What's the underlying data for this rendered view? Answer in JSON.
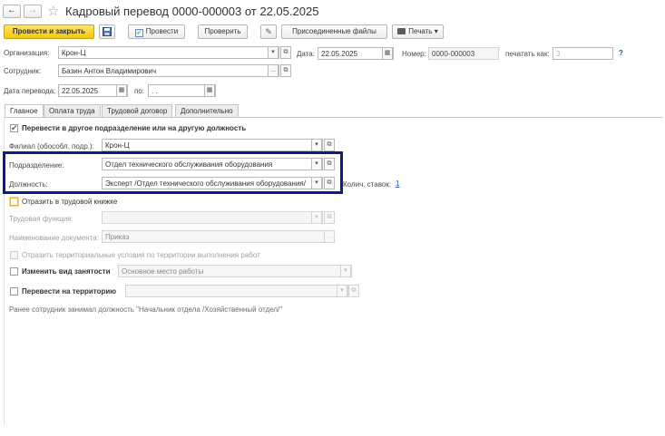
{
  "window": {
    "title": "Кадровый перевод 0000-000003 от 22.05.2025",
    "back_glyph": "←",
    "forward_glyph": "→",
    "star_glyph": "☆"
  },
  "toolbar": {
    "post_close": "Провести и закрыть",
    "save_icon": "floppy-disk-icon",
    "post": "Провести",
    "check": "Проверить",
    "attached_files": "Присоединенные файлы",
    "print": "Печать",
    "print_arrow": "▾"
  },
  "header": {
    "org_label": "Организация:",
    "org_value": "Крон-Ц",
    "date_label": "Дата:",
    "date_value": "22.05.2025",
    "number_label": "Номер:",
    "number_value": "0000-000003",
    "print_as_label": "печатать как:",
    "print_as_placeholder": "3",
    "help": "?",
    "employee_label": "Сотрудник:",
    "employee_value": "Базин Антон Владимирович",
    "transfer_date_label": "Дата перевода:",
    "transfer_date_value": "22.05.2025",
    "to_label": "по:",
    "to_value": " .  .",
    "dots": "...",
    "open_glyph": "⧉",
    "dropdown_glyph": "▾",
    "calendar_glyph": "▦"
  },
  "tabs": [
    "Главное",
    "Оплата труда",
    "Трудовой договор",
    "Дополнительно"
  ],
  "main": {
    "transfer_check": "✔",
    "transfer_label": "Перевести в другое подразделение или на другую должность",
    "branch_label": "Филиал (обособл. подр.):",
    "branch_value": "Крон-Ц",
    "department_label": "Подразделение:",
    "department_value": "Отдел технического обслуживания оборудования",
    "position_label": "Должность:",
    "position_value": "Эксперт /Отдел технического обслуживания оборудования/",
    "rates_label": "Колич. ставок:",
    "rates_value": "1",
    "workbook_label": "Отразить в трудовой книжке",
    "labor_function_label": "Трудовая функция:",
    "doc_name_label": "Наименование документа:",
    "doc_name_value": "Приказ",
    "territorial_label": "Отразить территориальные условия по территории выполнения работ",
    "employment_type_label": "Изменить вид занятости",
    "employment_type_value": "Основное место работы",
    "territory_label": "Перевести на территорию",
    "previous_note": "Ранее сотрудник занимал должность \"Начальник отдела /Хозяйственный отдел/\""
  },
  "colors": {
    "highlight_border": "#0d1b8c",
    "primary_button": "#f3c60e",
    "link": "#1b4e9b"
  }
}
